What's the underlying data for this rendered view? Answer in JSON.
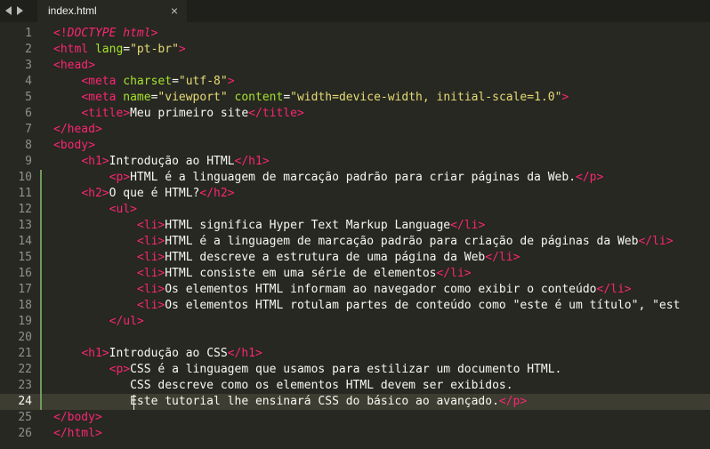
{
  "tab": {
    "title": "index.html",
    "close_glyph": "×"
  },
  "nav": {
    "back_icon": "chevron-left-icon",
    "forward_icon": "chevron-right-icon"
  },
  "editor": {
    "active_line": 24,
    "modified_lines": [
      10,
      11,
      12,
      13,
      14,
      15,
      16,
      17,
      18,
      19,
      20,
      21,
      22,
      23,
      24
    ],
    "colors": {
      "background": "#272822",
      "tag": "#f92672",
      "attribute": "#a6e22e",
      "string": "#e6db74",
      "text": "#f8f8f2",
      "line_number": "#90908a",
      "modified_marker": "#6f9a5c"
    },
    "lines": [
      {
        "n": "1",
        "tokens": [
          {
            "t": "<!",
            "c": "tag"
          },
          {
            "t": "DOCTYPE html",
            "c": "doctype"
          },
          {
            "t": ">",
            "c": "tag"
          }
        ]
      },
      {
        "n": "2",
        "tokens": [
          {
            "t": "<html ",
            "c": "tag"
          },
          {
            "t": "lang",
            "c": "attr"
          },
          {
            "t": "=",
            "c": "text"
          },
          {
            "t": "\"pt-br\"",
            "c": "str"
          },
          {
            "t": ">",
            "c": "tag"
          }
        ]
      },
      {
        "n": "3",
        "tokens": [
          {
            "t": "<head>",
            "c": "tag"
          }
        ]
      },
      {
        "n": "4",
        "tokens": [
          {
            "t": "    ",
            "c": "text"
          },
          {
            "t": "<meta ",
            "c": "tag"
          },
          {
            "t": "charset",
            "c": "attr"
          },
          {
            "t": "=",
            "c": "text"
          },
          {
            "t": "\"utf-8\"",
            "c": "str"
          },
          {
            "t": ">",
            "c": "tag"
          }
        ]
      },
      {
        "n": "5",
        "tokens": [
          {
            "t": "    ",
            "c": "text"
          },
          {
            "t": "<meta ",
            "c": "tag"
          },
          {
            "t": "name",
            "c": "attr"
          },
          {
            "t": "=",
            "c": "text"
          },
          {
            "t": "\"viewport\"",
            "c": "str"
          },
          {
            "t": " ",
            "c": "text"
          },
          {
            "t": "content",
            "c": "attr"
          },
          {
            "t": "=",
            "c": "text"
          },
          {
            "t": "\"width=device-width, initial-scale=1.0\"",
            "c": "str"
          },
          {
            "t": ">",
            "c": "tag"
          }
        ]
      },
      {
        "n": "6",
        "tokens": [
          {
            "t": "    ",
            "c": "text"
          },
          {
            "t": "<title>",
            "c": "tag"
          },
          {
            "t": "Meu primeiro site",
            "c": "text"
          },
          {
            "t": "</title>",
            "c": "tag"
          }
        ]
      },
      {
        "n": "7",
        "tokens": [
          {
            "t": "</head>",
            "c": "tag"
          }
        ]
      },
      {
        "n": "8",
        "tokens": [
          {
            "t": "<body>",
            "c": "tag"
          }
        ]
      },
      {
        "n": "9",
        "tokens": [
          {
            "t": "    ",
            "c": "text"
          },
          {
            "t": "<h1>",
            "c": "tag"
          },
          {
            "t": "Introdução ao HTML",
            "c": "text"
          },
          {
            "t": "</h1>",
            "c": "tag"
          }
        ]
      },
      {
        "n": "10",
        "tokens": [
          {
            "t": "        ",
            "c": "text"
          },
          {
            "t": "<p>",
            "c": "tag"
          },
          {
            "t": "HTML é a linguagem de marcação padrão para criar páginas da Web.",
            "c": "text"
          },
          {
            "t": "</p>",
            "c": "tag"
          }
        ]
      },
      {
        "n": "11",
        "tokens": [
          {
            "t": "    ",
            "c": "text"
          },
          {
            "t": "<h2>",
            "c": "tag"
          },
          {
            "t": "O que é HTML?",
            "c": "text"
          },
          {
            "t": "</h2>",
            "c": "tag"
          }
        ]
      },
      {
        "n": "12",
        "tokens": [
          {
            "t": "        ",
            "c": "text"
          },
          {
            "t": "<ul>",
            "c": "tag"
          }
        ]
      },
      {
        "n": "13",
        "tokens": [
          {
            "t": "            ",
            "c": "text"
          },
          {
            "t": "<li>",
            "c": "tag"
          },
          {
            "t": "HTML significa Hyper Text Markup Language",
            "c": "text"
          },
          {
            "t": "</li>",
            "c": "tag"
          }
        ]
      },
      {
        "n": "14",
        "tokens": [
          {
            "t": "            ",
            "c": "text"
          },
          {
            "t": "<li>",
            "c": "tag"
          },
          {
            "t": "HTML é a linguagem de marcação padrão para criação de páginas da Web",
            "c": "text"
          },
          {
            "t": "</li>",
            "c": "tag"
          }
        ]
      },
      {
        "n": "15",
        "tokens": [
          {
            "t": "            ",
            "c": "text"
          },
          {
            "t": "<li>",
            "c": "tag"
          },
          {
            "t": "HTML descreve a estrutura de uma página da Web",
            "c": "text"
          },
          {
            "t": "</li>",
            "c": "tag"
          }
        ]
      },
      {
        "n": "16",
        "tokens": [
          {
            "t": "            ",
            "c": "text"
          },
          {
            "t": "<li>",
            "c": "tag"
          },
          {
            "t": "HTML consiste em uma série de elementos",
            "c": "text"
          },
          {
            "t": "</li>",
            "c": "tag"
          }
        ]
      },
      {
        "n": "17",
        "tokens": [
          {
            "t": "            ",
            "c": "text"
          },
          {
            "t": "<li>",
            "c": "tag"
          },
          {
            "t": "Os elementos HTML informam ao navegador como exibir o conteúdo",
            "c": "text"
          },
          {
            "t": "</li>",
            "c": "tag"
          }
        ]
      },
      {
        "n": "18",
        "tokens": [
          {
            "t": "            ",
            "c": "text"
          },
          {
            "t": "<li>",
            "c": "tag"
          },
          {
            "t": "Os elementos HTML rotulam partes de conteúdo como \"este é um título\", \"est",
            "c": "text"
          }
        ]
      },
      {
        "n": "19",
        "tokens": [
          {
            "t": "        ",
            "c": "text"
          },
          {
            "t": "</ul>",
            "c": "tag"
          }
        ]
      },
      {
        "n": "20",
        "tokens": []
      },
      {
        "n": "21",
        "tokens": [
          {
            "t": "    ",
            "c": "text"
          },
          {
            "t": "<h1>",
            "c": "tag"
          },
          {
            "t": "Introdução ao CSS",
            "c": "text"
          },
          {
            "t": "</h1>",
            "c": "tag"
          }
        ]
      },
      {
        "n": "22",
        "tokens": [
          {
            "t": "        ",
            "c": "text"
          },
          {
            "t": "<p>",
            "c": "tag"
          },
          {
            "t": "CSS é a linguagem que usamos para estilizar um documento HTML.",
            "c": "text"
          }
        ]
      },
      {
        "n": "23",
        "tokens": [
          {
            "t": "           CSS descreve como os elementos HTML devem ser exibidos.",
            "c": "text"
          }
        ]
      },
      {
        "n": "24",
        "tokens": [
          {
            "t": "           Este tutorial lhe ensinará CSS do básico ao avançado.",
            "c": "text"
          },
          {
            "t": "</p>",
            "c": "tag"
          }
        ]
      },
      {
        "n": "25",
        "tokens": [
          {
            "t": "</body>",
            "c": "tag"
          }
        ]
      },
      {
        "n": "26",
        "tokens": [
          {
            "t": "</html>",
            "c": "tag"
          }
        ]
      }
    ]
  }
}
